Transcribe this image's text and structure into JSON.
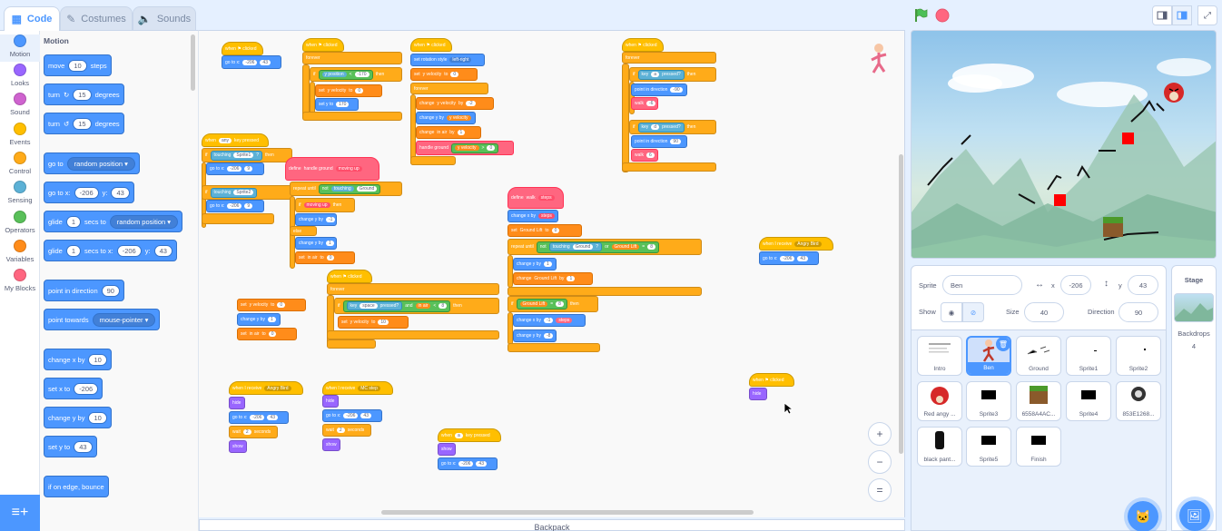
{
  "tabs": [
    {
      "label": "Code",
      "icon": "code-icon"
    },
    {
      "label": "Costumes",
      "icon": "brush-icon"
    },
    {
      "label": "Sounds",
      "icon": "speaker-icon"
    }
  ],
  "categories": [
    {
      "label": "Motion",
      "color": "#4c97ff"
    },
    {
      "label": "Looks",
      "color": "#9966ff"
    },
    {
      "label": "Sound",
      "color": "#cf63cf"
    },
    {
      "label": "Events",
      "color": "#ffbf00"
    },
    {
      "label": "Control",
      "color": "#ffab19"
    },
    {
      "label": "Sensing",
      "color": "#5cb1d6"
    },
    {
      "label": "Operators",
      "color": "#59c059"
    },
    {
      "label": "Variables",
      "color": "#ff8c1a"
    },
    {
      "label": "My Blocks",
      "color": "#ff6680"
    }
  ],
  "palette": {
    "section_title": "Motion",
    "move": {
      "pre": "move",
      "value": "10",
      "post": "steps"
    },
    "turn_right": {
      "pre": "turn",
      "value": "15",
      "post": "degrees"
    },
    "turn_left": {
      "pre": "turn",
      "value": "15",
      "post": "degrees"
    },
    "go_to": {
      "pre": "go to",
      "option": "random position"
    },
    "go_to_xy": {
      "pre": "go to x:",
      "x": "-206",
      "mid": "y:",
      "y": "43"
    },
    "glide_to": {
      "pre": "glide",
      "value": "1",
      "mid": "secs to",
      "option": "random position"
    },
    "glide_xy": {
      "pre": "glide",
      "value": "1",
      "mid": "secs to x:",
      "x": "-206",
      "mid2": "y:",
      "y": "43"
    },
    "point_dir": {
      "pre": "point in direction",
      "value": "90"
    },
    "point_towards": {
      "pre": "point towards",
      "option": "mouse-pointer"
    },
    "change_x": {
      "pre": "change x by",
      "value": "10"
    },
    "set_x": {
      "pre": "set x to",
      "value": "-206"
    },
    "change_y": {
      "pre": "change y by",
      "value": "10"
    },
    "set_y": {
      "pre": "set y to",
      "value": "43"
    },
    "edge_bounce": {
      "label": "if on edge, bounce"
    }
  },
  "workspace": {
    "s1_hat": "when ⚑ clicked",
    "s1_goto": "go to x:",
    "s1_x": "-206",
    "s1_y": "43",
    "s2_hat": "when ⚑ clicked",
    "s2_forever": "forever",
    "s2_if": "if",
    "s2_ypos": "y position",
    "s2_lt": "<",
    "s2_val": "-170",
    "s2_then": "then",
    "s2_set": "set",
    "s2_var": "y velocity",
    "s2_to": "to",
    "s2_zero": "0",
    "s2_sety": "set y to",
    "s2_170": "170",
    "s3_hat": "when ⚑ clicked",
    "s3_rot": "set rotation style",
    "s3_rotopt": "left-right",
    "s3_set": "set",
    "s3_var": "y velocity",
    "s3_to": "to",
    "s3_zero": "0",
    "s3_forever": "forever",
    "s3_change": "change",
    "s3_cvar": "y velocity",
    "s3_by": "by",
    "s3_m2": "-2",
    "s3_changey": "change y by",
    "s3_yvel": "y velocity",
    "s3_change2": "change",
    "s3_inair": "in air",
    "s3_by2": "by",
    "s3_one": "1",
    "s3_handle": "handle ground",
    "s3_yvel2": "y velocity",
    "s3_gt": ">",
    "s3_zero2": "0",
    "s4_hat": "when ⚑ clicked",
    "s4_forever": "forever",
    "s4_if1": "if",
    "s4_key1": "key",
    "s4_a": "a",
    "s4_pressed1": "pressed?",
    "s4_then1": "then",
    "s4_point1": "point in direction",
    "s4_m90": "-90",
    "s4_walk1": "walk",
    "s4_m6": "-6",
    "s4_if2": "if",
    "s4_key2": "key",
    "s4_d": "d",
    "s4_pressed2": "pressed?",
    "s4_then2": "then",
    "s4_point2": "point in direction",
    "s4_90": "90",
    "s4_walk2": "walk",
    "s4_6": "6",
    "s5_hat": "when",
    "s5_any": "any",
    "s5_keyp": "key pressed",
    "s5_if": "if",
    "s5_touch": "touching",
    "s5_sp1": "Sprite1",
    "s5_q": "?",
    "s5_then": "then",
    "s5_goto": "go to x:",
    "s5_x": "-206",
    "s5_y": "9",
    "s5_if2": "if",
    "s5_touch2": "touching",
    "s5_sp2": "Sprite2",
    "s5_goto2": "go to x:",
    "s5_x2": "-206",
    "s5_y2": "9",
    "s6_define": "define",
    "s6_name": "handle ground",
    "s6_param": "moving up",
    "s6_until": "repeat until",
    "s6_not": "not",
    "s6_touch": "touching",
    "s6_ground": "Ground",
    "s6_if": "if",
    "s6_mu": "moving up",
    "s6_then": "then",
    "s6_cy": "change y by",
    "s6_m1": "-1",
    "s6_else": "else",
    "s6_cy2": "change y by",
    "s6_one": "1",
    "s6_set": "set",
    "s6_inair": "in air",
    "s6_to": "to",
    "s6_zero": "0",
    "s7_hat": "when ⚑ clicked",
    "s7_forever": "forever",
    "s7_if": "if",
    "s7_key": "key",
    "s7_space": "space",
    "s7_pressed": "pressed?",
    "s7_and": "and",
    "s7_inair": "in air",
    "s7_lt": "<",
    "s7_8": "8",
    "s7_then": "then",
    "s7_set": "set",
    "s7_yvel": "y velocity",
    "s7_to": "to",
    "s7_10": "10",
    "s8_set": "set",
    "s8_var": "y velocity",
    "s8_to": "to",
    "s8_zero": "0",
    "s8_cy": "change y by",
    "s8_one": "1",
    "s8_set2": "set",
    "s8_inair": "in air",
    "s8_to2": "to",
    "s8_zero2": "0",
    "s9_define": "define",
    "s9_walk": "walk",
    "s9_steps": "steps",
    "s9_cx": "change x by",
    "s9_steps2": "steps",
    "s9_set": "set",
    "s9_gl": "Ground Lift",
    "s9_to": "to",
    "s9_zero": "0",
    "s9_until": "repeat until",
    "s9_not": "not",
    "s9_touch": "touching",
    "s9_ground": "Ground",
    "s9_q": "?",
    "s9_or": "or",
    "s9_gl2": "Ground Lift",
    "s9_eq": "=",
    "s9_8": "8",
    "s9_cy": "change y by",
    "s9_one": "1",
    "s9_change": "change",
    "s9_gl3": "Ground Lift",
    "s9_by": "by",
    "s9_one2": "1",
    "s9_if": "if",
    "s9_gl4": "Ground Lift",
    "s9_eq2": "=",
    "s9_8b": "8",
    "s9_then": "then",
    "s9_cx2": "change x by",
    "s9_m1": "-1",
    "s9_steps3": "steps",
    "s9_cy2": "change y by",
    "s9_m8": "-8",
    "s10_hat": "when I receive",
    "s10_msg": "Angry Bird",
    "s10_goto": "go to x:",
    "s10_x": "-206",
    "s10_y": "43",
    "s11_hat": "when I receive",
    "s11_msg": "Angry Bird",
    "s11_hide": "hide",
    "s11_goto": "go to x:",
    "s11_x": "-206",
    "s11_y": "43",
    "s11_wait": "wait",
    "s11_2": "2",
    "s11_secs": "seconds",
    "s11_show": "show",
    "s12_hat": "when I receive",
    "s12_msg": "MC step",
    "s12_hide": "hide",
    "s12_goto": "go to x:",
    "s12_x": "-206",
    "s12_y": "43",
    "s12_wait": "wait",
    "s12_2": "2",
    "s12_secs": "seconds",
    "s12_show": "show",
    "s13_hat": "when",
    "s13_key": "a",
    "s13_kp": "key pressed",
    "s13_show": "show",
    "s13_goto": "go to x:",
    "s13_x": "-206",
    "s13_y": "43",
    "s14_hat": "when ⚑ clicked",
    "s14_hide": "hide"
  },
  "backpack_label": "Backpack",
  "sprite_info": {
    "sprite_label": "Sprite",
    "sprite_name": "Ben",
    "x_label": "x",
    "x_value": "-206",
    "y_label": "y",
    "y_value": "43",
    "show_label": "Show",
    "size_label": "Size",
    "size_value": "40",
    "direction_label": "Direction",
    "direction_value": "90"
  },
  "sprites": [
    {
      "name": "Intro"
    },
    {
      "name": "Ben"
    },
    {
      "name": "Ground"
    },
    {
      "name": "Sprite1"
    },
    {
      "name": "Sprite2"
    },
    {
      "name": "Red angy ..."
    },
    {
      "name": "Sprite3"
    },
    {
      "name": "6558A4AC..."
    },
    {
      "name": "Sprite4"
    },
    {
      "name": "853E1268..."
    },
    {
      "name": "black pant..."
    },
    {
      "name": "Sprite5"
    },
    {
      "name": "Finish"
    }
  ],
  "stage_panel": {
    "title": "Stage",
    "backdrops_label": "Backdrops",
    "backdrops_count": "4"
  },
  "colors": {
    "accent": "#4c97ff",
    "green_flag": "#4cbf56",
    "stop": "#ff6680"
  }
}
